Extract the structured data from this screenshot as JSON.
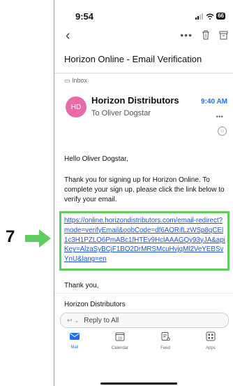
{
  "annotation": {
    "step_number": "7"
  },
  "status_bar": {
    "time": "9:54",
    "battery": "66"
  },
  "email": {
    "subject": "Horizon Online - Email Verification",
    "folder": "Inbox",
    "avatar_initials": "HD",
    "sender": "Horizon Distributors",
    "time": "9:40 AM",
    "to": "To Oliver Dogstar",
    "greeting": "Hello Oliver Dogstar,",
    "body": "Thank you for signing up for Horizon Online. To complete your sign up, please click the link below to verify your email.",
    "link": "https://online.horizondistributors.com/email-redirect?mode=verifyEmail&oobCode=df6AORifLzWSp8qCEl1c3H1PZLO6PmABc1fHTEv9HclAAAGQy93yJA&apiKey=AlzaSyBCjF1BO2DrMRSMcuHvjqMl2VeYEBSvYnU&lang=en",
    "thanks": "Thank you,",
    "signature": "Horizon Distributors"
  },
  "reply": {
    "label": "Reply to All"
  },
  "tabs": [
    {
      "label": "Mail",
      "icon": "mail-icon"
    },
    {
      "label": "Calendar",
      "icon": "calendar-icon",
      "day": "19"
    },
    {
      "label": "Feed",
      "icon": "feed-icon"
    },
    {
      "label": "Apps",
      "icon": "apps-icon"
    }
  ],
  "colors": {
    "accent": "#1a73e8",
    "link": "#1a55d8",
    "highlight": "#5fcc5f",
    "avatar": "#e86aa8"
  }
}
